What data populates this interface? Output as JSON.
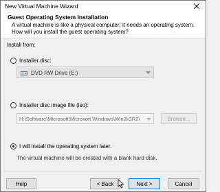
{
  "window": {
    "title": "New Virtual Machine Wizard"
  },
  "header": {
    "title": "Guest Operating System Installation",
    "subtitle": "A virtual machine is like a physical computer; it needs an operating system. How will you install the guest operating system?"
  },
  "install_from": {
    "label": "Install from:",
    "options": [
      {
        "label": "Installer disc:",
        "selected": false
      },
      {
        "label": "Installer disc image file (iso):",
        "selected": false
      },
      {
        "label": "I will install the operating system later.",
        "selected": true
      }
    ],
    "disc_drive": "DVD RW Drive (E:)",
    "iso_path": "H:\\Software\\Microsoft\\Microsoft Windows\\Win2k3R2\\",
    "browse_label": "Browse...",
    "later_note": "The virtual machine will be created with a blank hard disk."
  },
  "buttons": {
    "help": "Help",
    "back": "< Back",
    "next": "Next >",
    "cancel": "Cancel"
  },
  "icons": [
    "close-icon",
    "dvd-drive-icon",
    "dropdown-arrow-icon",
    "mouse-cursor-icon"
  ]
}
